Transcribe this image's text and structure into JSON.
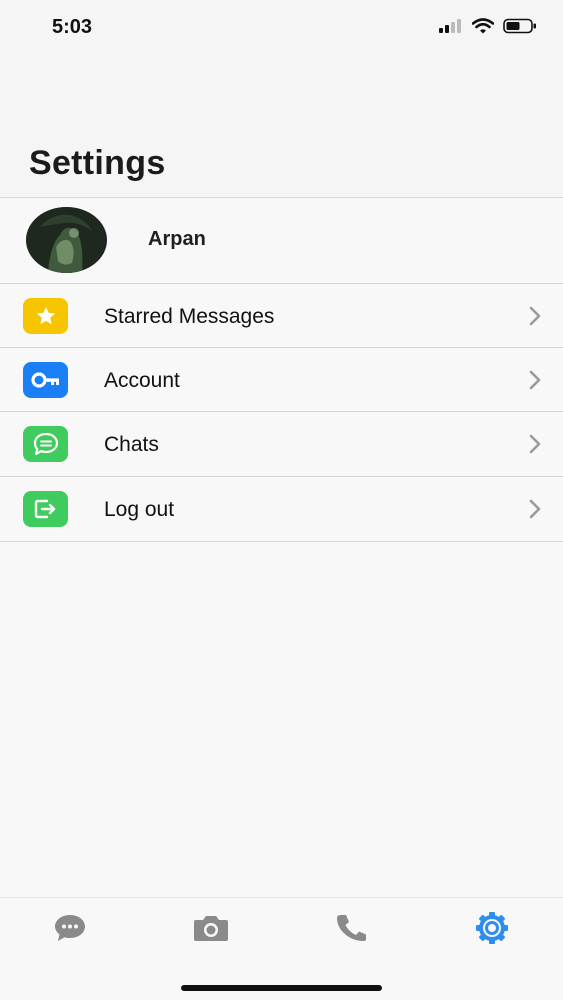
{
  "status_bar": {
    "time": "5:03"
  },
  "header": {
    "title": "Settings"
  },
  "profile": {
    "name": "Arpan"
  },
  "menu": [
    {
      "label": "Starred Messages",
      "icon": "star-icon",
      "color": "#f6c500"
    },
    {
      "label": "Account",
      "icon": "key-icon",
      "color": "#1a7ef5"
    },
    {
      "label": "Chats",
      "icon": "chat-bubble-icon",
      "color": "#3fcb5d"
    },
    {
      "label": "Log out",
      "icon": "logout-icon",
      "color": "#3fcb5d"
    }
  ],
  "tab_bar": {
    "tabs": [
      {
        "icon": "chats-icon",
        "active": false
      },
      {
        "icon": "camera-icon",
        "active": false
      },
      {
        "icon": "phone-icon",
        "active": false
      },
      {
        "icon": "settings-gear-icon",
        "active": true
      }
    ],
    "active_color": "#2d8ef0",
    "inactive_color": "#8a8a8a"
  }
}
